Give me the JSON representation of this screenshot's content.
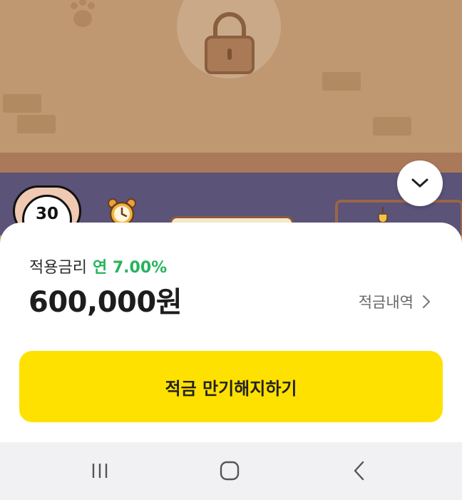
{
  "scene": {
    "badge_number": "30"
  },
  "sheet": {
    "rate_label": "적용금리",
    "rate_value": "연 7.00%",
    "amount": "600,000원",
    "history_label": "적금내역",
    "cta_label": "적금 만기해지하기"
  },
  "icons": {
    "collapse": "chevron-down-icon",
    "lock": "lock-icon",
    "history_arrow": "chevron-right-icon",
    "nav_recents": "recent-apps-icon",
    "nav_home": "home-icon",
    "nav_back": "back-icon"
  },
  "colors": {
    "accent_green": "#27b35e",
    "cta_yellow": "#ffe100",
    "wall": "#bf9871",
    "shelf": "#5b5378"
  }
}
